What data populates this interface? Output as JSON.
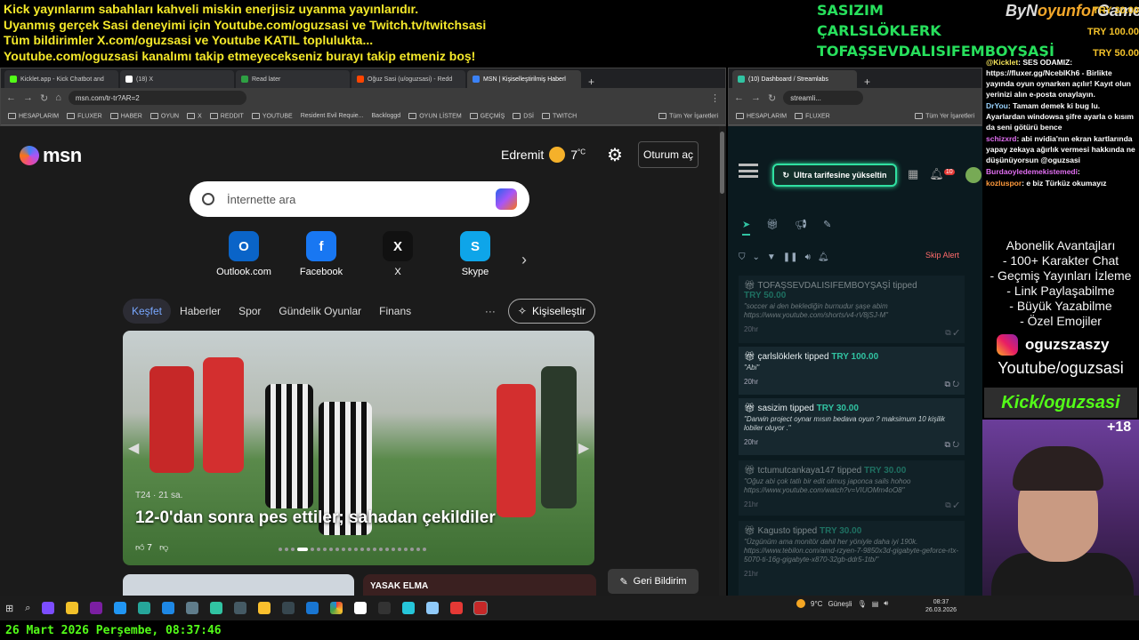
{
  "banner": {
    "lines": [
      "Kick yayınlarım sabahları kahveli miskin enerjisiz uyanma yayınlarıdır.",
      "Uyanmış gerçek Sasi deneyimi için Youtube.com/oguzsasi ve Twitch.tv/twitchsasi",
      "Tüm bildirimler X.com/oguzsasi ve Youtube KATIL toplulukta...",
      "Youtube.com/oguzsasi kanalımı takip etmeyecekseniz burayı takip etmeniz boş!"
    ]
  },
  "top_supporters": [
    "SASIZIM",
    "ÇARLSLÖKLERK",
    "TOFAŞSEVDALISIFEMBOYŞAŞİ"
  ],
  "brand": {
    "prefix": "ByN",
    "accent": "oyunfor",
    "suffix": "Game"
  },
  "top_tips": [
    "TRY 30.00",
    "TRY 100.00",
    "TRY 50.00"
  ],
  "left_browser": {
    "tabs": [
      "Kicklet.app - Kick Chatbot and",
      "(18) X",
      "Read later",
      "Oğuz Sasi (u/oguzsasi) - Redd",
      "MSN | Kişiselleştirilmiş Haberl"
    ],
    "url": "msn.com/tr-tr?AR=2",
    "bookmarks": [
      "HESAPLARIM",
      "FLUXER",
      "HABER",
      "OYUN",
      "X",
      "REDDIT",
      "YOUTUBE",
      "Resident Evil Requie...",
      "Backloggd",
      "OYUN LİSTEM",
      "GEÇMİŞ",
      "DSİ",
      "TWITCH"
    ],
    "bookmarks_other": "Tüm Yer İşaretleri"
  },
  "msn": {
    "logo": "msn",
    "location": "Edremit",
    "temp": "7",
    "temp_unit": "°C",
    "login": "Oturum aç",
    "search_placeholder": "İnternette ara",
    "shortcuts": [
      {
        "label": "Outlook.com",
        "glyph": "O",
        "color": "#0a64c8"
      },
      {
        "label": "Facebook",
        "glyph": "f",
        "color": "#1877f2"
      },
      {
        "label": "X",
        "glyph": "X",
        "color": "#111111"
      },
      {
        "label": "Skype",
        "glyph": "S",
        "color": "#0ea5e9"
      }
    ],
    "categories": [
      "Keşfet",
      "Haberler",
      "Spor",
      "Gündelik Oyunlar",
      "Finans"
    ],
    "more": "···",
    "personalize": "Kişiselleştir",
    "hero": {
      "source": "T24 · 21 sa.",
      "title": "12-0'dan sonra pes ettiler; sahadan çekildiler",
      "likes": "7"
    },
    "card3_label": "YASAK ELMA",
    "feedback": "Geri Bildirim"
  },
  "right_browser": {
    "tabs": [
      "(10) Dashboard / Streamlabs"
    ],
    "url": "streamli...",
    "bookmarks": [
      "HESAPLARIM",
      "FLUXER"
    ],
    "bookmarks_other": "Tüm Yer İşaretleri"
  },
  "streamlabs": {
    "upgrade": "Ultra tarifesine yükseltin",
    "notif_count": "10",
    "skip_alert": "Skip Alert",
    "alerts": [
      {
        "user": "TOFAŞSEVDALISIFEMBOYŞAŞİ",
        "verb": "tipped",
        "amount": "TRY 50.00",
        "message": "\"soccer ai den beklediğin burnudur şaşe abim https://www.youtube.com/shorts/v4-rV8jSJ-M\"",
        "time": "20hr",
        "dim": true
      },
      {
        "user": "çarlslöklerk",
        "verb": "tipped",
        "amount": "TRY 100.00",
        "message": "\"Abi\"",
        "time": "20hr",
        "dim": false
      },
      {
        "user": "sasizim",
        "verb": "tipped",
        "amount": "TRY 30.00",
        "message": "\"Darwin project oynar mısın bedava oyun ? maksimum 10 kişilik lobiler oluyor .\"",
        "time": "20hr",
        "dim": false
      },
      {
        "user": "tctumutcankaya147",
        "verb": "tipped",
        "amount": "TRY 30.00",
        "message": "\"Oğuz abi çok tatlı bir edit olmuş japonca sails hohoo https://www.youtube.com/watch?v=VIUOMm4oO8\"",
        "time": "21hr",
        "dim": true
      },
      {
        "user": "Kagusto",
        "verb": "tipped",
        "amount": "TRY 30.00",
        "message": "\"Üzgünüm ama monitör dahil her yöniyle daha iyi 190k. https://www.tebilon.com/amd-rzyen-7-9850x3d-gigabyte-geforce-rtx-5070-ti-16g-gigabyte-x870-32gb-ddr5-1tb/\"",
        "time": "21hr",
        "dim": true
      }
    ]
  },
  "chat": [
    {
      "user": "@Kicklet",
      "text": ": SES ODAMIZ: https://fluxer.gg/NceblKh6 - Birlikte yayında oyun oynarken açılır! Kayıt olun yerinizi alın e-posta onaylayın.",
      "cls": "g"
    },
    {
      "user": "DrYou",
      "text": ": Tamam demek ki bug lu. Ayarlardan windowsa şifre ayarla o kısım da seni götürü bence",
      "cls": ""
    },
    {
      "user": "schizxrd",
      "text": ": abi nvidia'nın ekran kartlarında yapay zekaya ağırlık vermesi hakkında ne düşünüyorsun @oguzsasi",
      "cls": "p"
    },
    {
      "user": "Burdaoyledemekistemedi",
      "text": ":",
      "cls": "p"
    },
    {
      "user": "kozluspor",
      "text": ": e biz Türküz okumayız",
      "cls": "o"
    }
  ],
  "perks": [
    "Abonelik Avantajları",
    "- 100+ Karakter Chat",
    "- Geçmiş Yayınları İzleme",
    "- Link Paylaşabilme",
    "- Büyük Yazabilme",
    "- Özel Emojiler"
  ],
  "instagram": "oguzszaszy",
  "youtube": "Youtube/oguzsasi",
  "kick": "Kick/oguzsasi",
  "age": "+18",
  "taskbar": {
    "weather": "9°C",
    "weather_label": "Güneşli",
    "time": "08:37",
    "date": "26.03.2026"
  },
  "datetime": "26 Mart 2026 Perşembe, 08:37:46"
}
